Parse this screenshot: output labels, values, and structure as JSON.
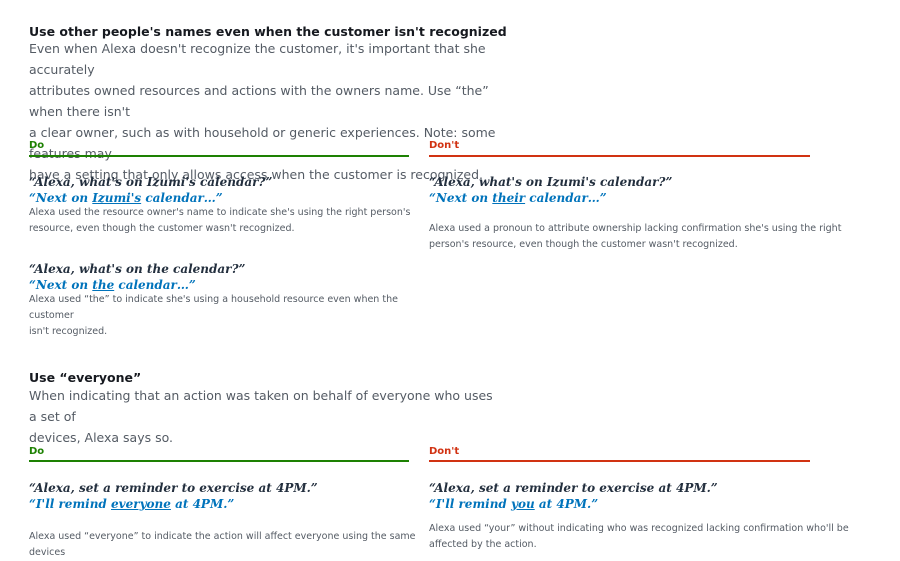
{
  "section1": {
    "title": "Use other people's names even when the customer isn't recognized",
    "description_lines": [
      "Even when Alexa doesn't recognize the customer, it's important that she accurately",
      "attributes owned resources and actions with the owners name. Use “the” when there isn't",
      "a clear owner, such as with household or generic experiences. Note: some features may",
      "have a setting that only allows access when the customer is recognized."
    ],
    "do_label": "Do",
    "dont_label": "Don't",
    "do_examples": [
      {
        "quote": "“Alexa, what's on Izumi's calendar?”",
        "resp_pre": "“Next on ",
        "resp_u": "Izumi's",
        "resp_post": " calendar…”",
        "note_lines": [
          "Alexa used the resource owner's name to indicate she's using the right person's",
          "resource, even though the customer wasn't recognized."
        ]
      },
      {
        "quote": "“Alexa, what's on the calendar?”",
        "resp_pre": "“Next on ",
        "resp_u": "the",
        "resp_post": " calendar…”",
        "note_lines": [
          "Alexa used “the” to indicate she's using a household resource even when the customer",
          "isn't recognized."
        ]
      }
    ],
    "dont_example": {
      "quote": "“Alexa, what's on Izumi's calendar?”",
      "resp_pre": "“Next on ",
      "resp_u": "their",
      "resp_post": " calendar…”",
      "note_lines": [
        "Alexa used a pronoun to attribute ownership lacking confirmation she's using the right",
        "person's resource, even though the customer wasn't recognized."
      ]
    }
  },
  "section2": {
    "title": "Use “everyone”",
    "description_lines": [
      "When indicating that an action was taken on behalf of everyone who uses a set of",
      "devices, Alexa says so."
    ],
    "do_label": "Do",
    "dont_label": "Don't",
    "do_example": {
      "quote": "“Alexa, set a reminder to exercise at 4PM.”",
      "resp_pre": "“I'll remind ",
      "resp_u": "everyone",
      "resp_post": " at 4PM.”",
      "note_lines": [
        "Alexa used “everyone” to indicate the action will affect everyone using the same devices"
      ]
    },
    "dont_example": {
      "quote": "“Alexa, set a reminder to exercise at 4PM.”",
      "resp_pre": "“I'll remind ",
      "resp_u": "you",
      "resp_post": " at 4PM.”",
      "note_lines": [
        "Alexa used “your” without indicating who was recognized lacking confirmation who'll be",
        "affected by the action."
      ]
    }
  },
  "colors": {
    "do": "#1d8102",
    "dont": "#d13212",
    "response": "#0073bb"
  }
}
